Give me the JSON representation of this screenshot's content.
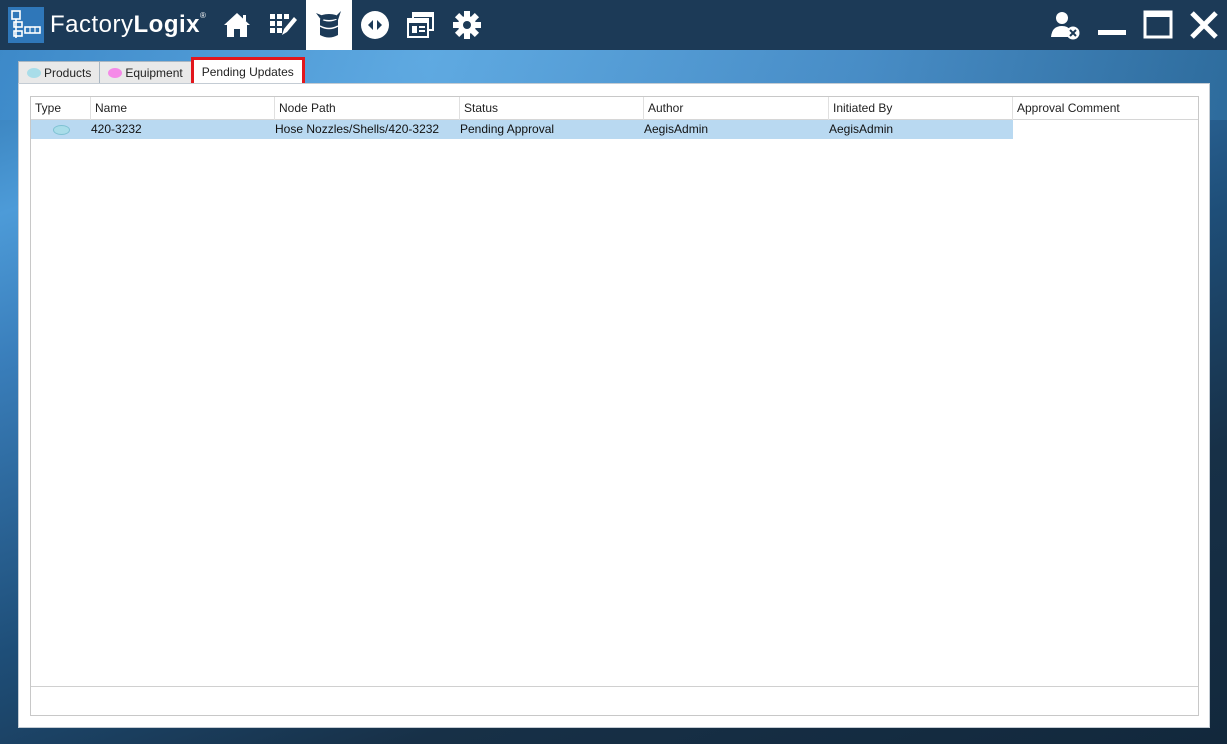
{
  "app": {
    "title_light": "Factory",
    "title_bold": "Logix",
    "trademark": "®",
    "brand_color": "#2f77b9"
  },
  "nav": [
    {
      "name": "home-icon",
      "active": false
    },
    {
      "name": "grid-edit-icon",
      "active": false
    },
    {
      "name": "database-icon",
      "active": true
    },
    {
      "name": "transfer-icon",
      "active": false
    },
    {
      "name": "windows-icon",
      "active": false
    },
    {
      "name": "gear-icon",
      "active": false
    }
  ],
  "window_controls": [
    "user-logout-icon",
    "minimize-icon",
    "maximize-icon",
    "close-icon"
  ],
  "tabs": [
    {
      "label": "Products",
      "dot_color": "#a9dde9"
    },
    {
      "label": "Equipment",
      "dot_color": "#f58ae8"
    },
    {
      "label": "Pending Updates",
      "selected": true
    }
  ],
  "table": {
    "columns": [
      "Type",
      "Name",
      "Node Path",
      "Status",
      "Author",
      "Initiated By",
      "Approval Comment"
    ],
    "rows": [
      {
        "type_color": "#a9dde9",
        "name": "420-3232",
        "node_path": "Hose Nozzles/Shells/420-3232",
        "status": "Pending Approval",
        "author": "AegisAdmin",
        "initiated_by": "AegisAdmin",
        "approval_comment": ""
      }
    ],
    "selected_row_color": "#b9d9f1"
  }
}
